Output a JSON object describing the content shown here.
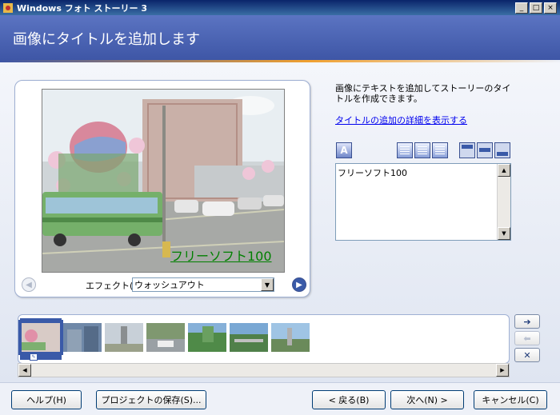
{
  "window": {
    "title": "Windows フォト ストーリー 3"
  },
  "header": {
    "title": "画像にタイトルを追加します"
  },
  "preview": {
    "overlay_text": "フリーソフト100",
    "effect_label": "エフェクト(E):",
    "effect_value": "ウォッシュアウト"
  },
  "side": {
    "instruction": "画像にテキストを追加してストーリーのタイトルを作成できます。",
    "link": "タイトルの追加の詳細を表示する",
    "text_value": "フリーソフト100"
  },
  "footer": {
    "help": "ヘルプ(H)",
    "save_project": "プロジェクトの保存(S)...",
    "back": "< 戻る(B)",
    "next": "次へ(N) >",
    "cancel": "キャンセル(C)"
  },
  "colors": {
    "header_bg": "#4a63b4",
    "accent_orange": "#f0a030",
    "overlay_text": "#008000",
    "link": "#0000ee"
  },
  "icons": {
    "prev": "left-arrow-circle-icon",
    "next": "right-arrow-circle-icon",
    "move_right": "right-arrow-icon",
    "move_left": "left-arrow-icon",
    "remove": "x-icon",
    "font": "font-icon"
  }
}
